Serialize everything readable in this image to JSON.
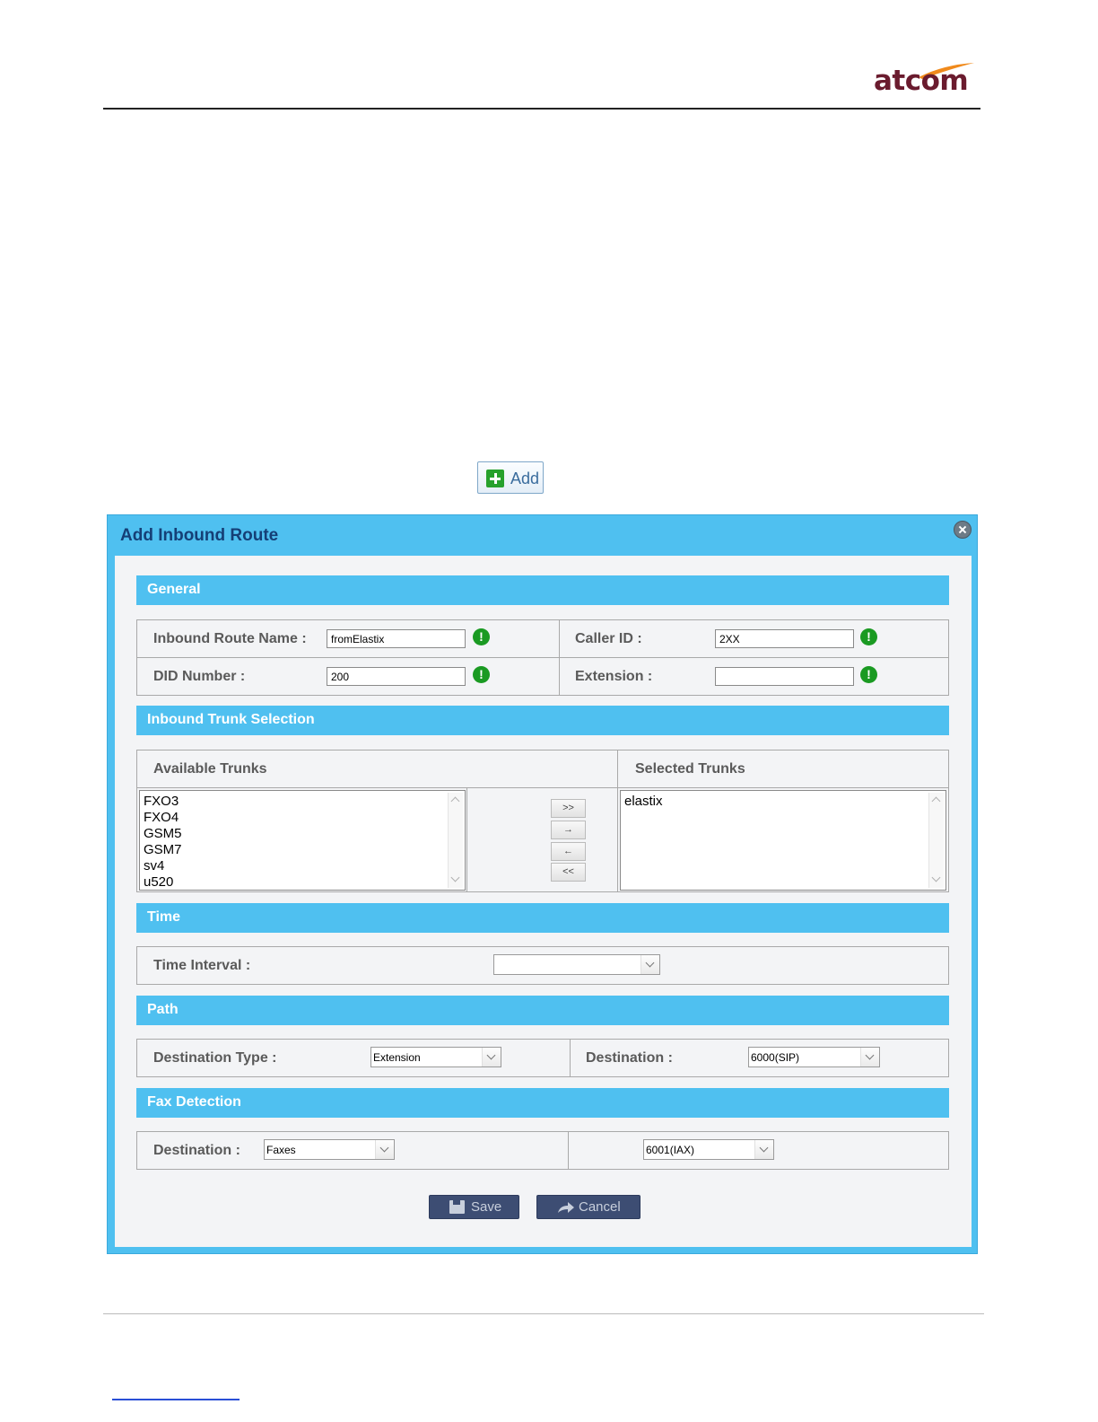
{
  "brand": {
    "logo_text": "atcom"
  },
  "toolbar": {
    "add_label": "Add"
  },
  "dialog": {
    "title": "Add Inbound Route",
    "sections": {
      "general": "General",
      "trunks": "Inbound Trunk Selection",
      "time": "Time",
      "path": "Path",
      "fax": "Fax Detection"
    },
    "general": {
      "route_name_label": "Inbound Route Name :",
      "route_name_value": "fromElastix",
      "caller_id_label": "Caller ID :",
      "caller_id_value": "2XX",
      "did_label": "DID Number :",
      "did_value": "200",
      "extension_label": "Extension :",
      "extension_value": ""
    },
    "trunks": {
      "available_label": "Available Trunks",
      "selected_label": "Selected Trunks",
      "available": [
        "FXO3",
        "FXO4",
        "GSM5",
        "GSM7",
        "sv4",
        "u520"
      ],
      "selected": [
        "elastix"
      ],
      "move_all_right": ">>",
      "move_right": "→",
      "move_left": "←",
      "move_all_left": "<<"
    },
    "time": {
      "interval_label": "Time Interval :",
      "interval_value": ""
    },
    "path": {
      "dest_type_label": "Destination Type :",
      "dest_type_value": "Extension",
      "destination_label": "Destination :",
      "destination_value": "6000(SIP)"
    },
    "fax": {
      "destination_label": "Destination :",
      "destination_value": "Faxes",
      "target_value": "6001(IAX)"
    },
    "buttons": {
      "save": "Save",
      "cancel": "Cancel"
    }
  },
  "colors": {
    "dialog_blue": "#4fc0f0",
    "title_blue": "#153f76",
    "button_dark": "#3d4d73",
    "valid_green": "#1a9a22"
  },
  "icons": [
    "plus-icon",
    "close-icon",
    "valid-icon",
    "floppy-icon",
    "share-arrow-icon"
  ]
}
